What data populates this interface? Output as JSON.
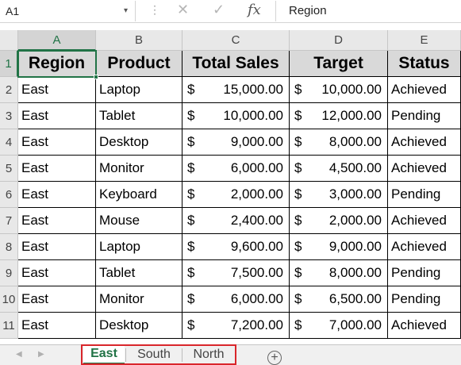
{
  "formula_bar": {
    "name_box": "A1",
    "dropdown_icon": "▾",
    "dots_icon": "⋮",
    "cancel_icon": "✕",
    "enter_icon": "✓",
    "fx_label": "fx",
    "content": "Region"
  },
  "columns": [
    "A",
    "B",
    "C",
    "D",
    "E"
  ],
  "rows": [
    "1",
    "2",
    "3",
    "4",
    "5",
    "6",
    "7",
    "8",
    "9",
    "10",
    "11"
  ],
  "currency_symbol": "$",
  "table": {
    "headers": [
      "Region",
      "Product",
      "Total Sales",
      "Target",
      "Status"
    ],
    "records": [
      [
        "East",
        "Laptop",
        "15,000.00",
        "10,000.00",
        "Achieved"
      ],
      [
        "East",
        "Tablet",
        "10,000.00",
        "12,000.00",
        "Pending"
      ],
      [
        "East",
        "Desktop",
        "9,000.00",
        "8,000.00",
        "Achieved"
      ],
      [
        "East",
        "Monitor",
        "6,000.00",
        "4,500.00",
        "Achieved"
      ],
      [
        "East",
        "Keyboard",
        "2,000.00",
        "3,000.00",
        "Pending"
      ],
      [
        "East",
        "Mouse",
        "2,400.00",
        "2,000.00",
        "Achieved"
      ],
      [
        "East",
        "Laptop",
        "9,600.00",
        "9,000.00",
        "Achieved"
      ],
      [
        "East",
        "Tablet",
        "7,500.00",
        "8,000.00",
        "Pending"
      ],
      [
        "East",
        "Monitor",
        "6,000.00",
        "6,500.00",
        "Pending"
      ],
      [
        "East",
        "Desktop",
        "7,200.00",
        "7,000.00",
        "Achieved"
      ]
    ]
  },
  "sheet_tabs": [
    {
      "label": "East",
      "active": true
    },
    {
      "label": "South",
      "active": false
    },
    {
      "label": "North",
      "active": false
    }
  ],
  "tab_nav": {
    "prev_icon": "◀",
    "next_icon": "▶"
  },
  "add_sheet_icon": "+",
  "colors": {
    "accent": "#217346",
    "highlight": "#d9262b",
    "header_fill": "#d9d9d9"
  }
}
